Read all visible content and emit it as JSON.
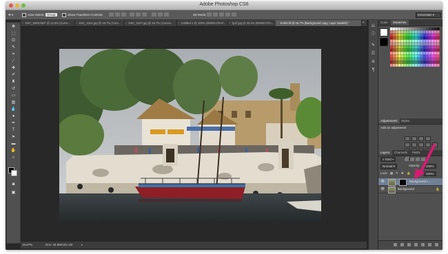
{
  "window": {
    "title": "Adobe Photoshop CS6"
  },
  "options_bar": {
    "auto_select_label": "Auto-Select:",
    "auto_select_value": "Group",
    "show_transform_label": "Show Transform Controls",
    "mode_3d_label": "3D Mode:",
    "workspace": "Essentials"
  },
  "tabs": [
    {
      "label": "DSC_0009.NEF @ 12.5% (Curve..."
    },
    {
      "label": "DSC_0341.jpg @ 16.7% (Curv..."
    },
    {
      "label": "DSC_0437.jpg @ 16.7% (Curves..."
    },
    {
      "label": "Untitled-1 @ 100% (WWW.CRAF..."
    },
    {
      "label": "fg.tif.jpg @ 33.3% (WWW.CRA..."
    },
    {
      "label": "to tilet.tif @ 16.7% (Background copy, Layer Mask/8) *"
    }
  ],
  "status_bar": {
    "zoom": "16.67%",
    "doc": "Doc: 34.9M/102.1M"
  },
  "panels": {
    "color_tabs": [
      "Color",
      "Swatches"
    ],
    "adjustments_tabs": [
      "Adjustments",
      "Styles"
    ],
    "adjustments_title": "Add an adjustment",
    "layers_tabs": [
      "Layers",
      "Channels",
      "Paths"
    ],
    "kind_filter": "Kind",
    "blend_mode": "Normal",
    "opacity_label": "Opacity:",
    "opacity_value": "100%",
    "lock_label": "Lock:",
    "fill_label": "Fill:",
    "fill_value": "100%",
    "layers": [
      {
        "name": "Background c...",
        "selected": true,
        "has_mask": true
      },
      {
        "name": "Background",
        "selected": false,
        "locked": true
      }
    ]
  },
  "accent": {
    "arrow": "#d81b72",
    "selection": "#6f7f96"
  }
}
